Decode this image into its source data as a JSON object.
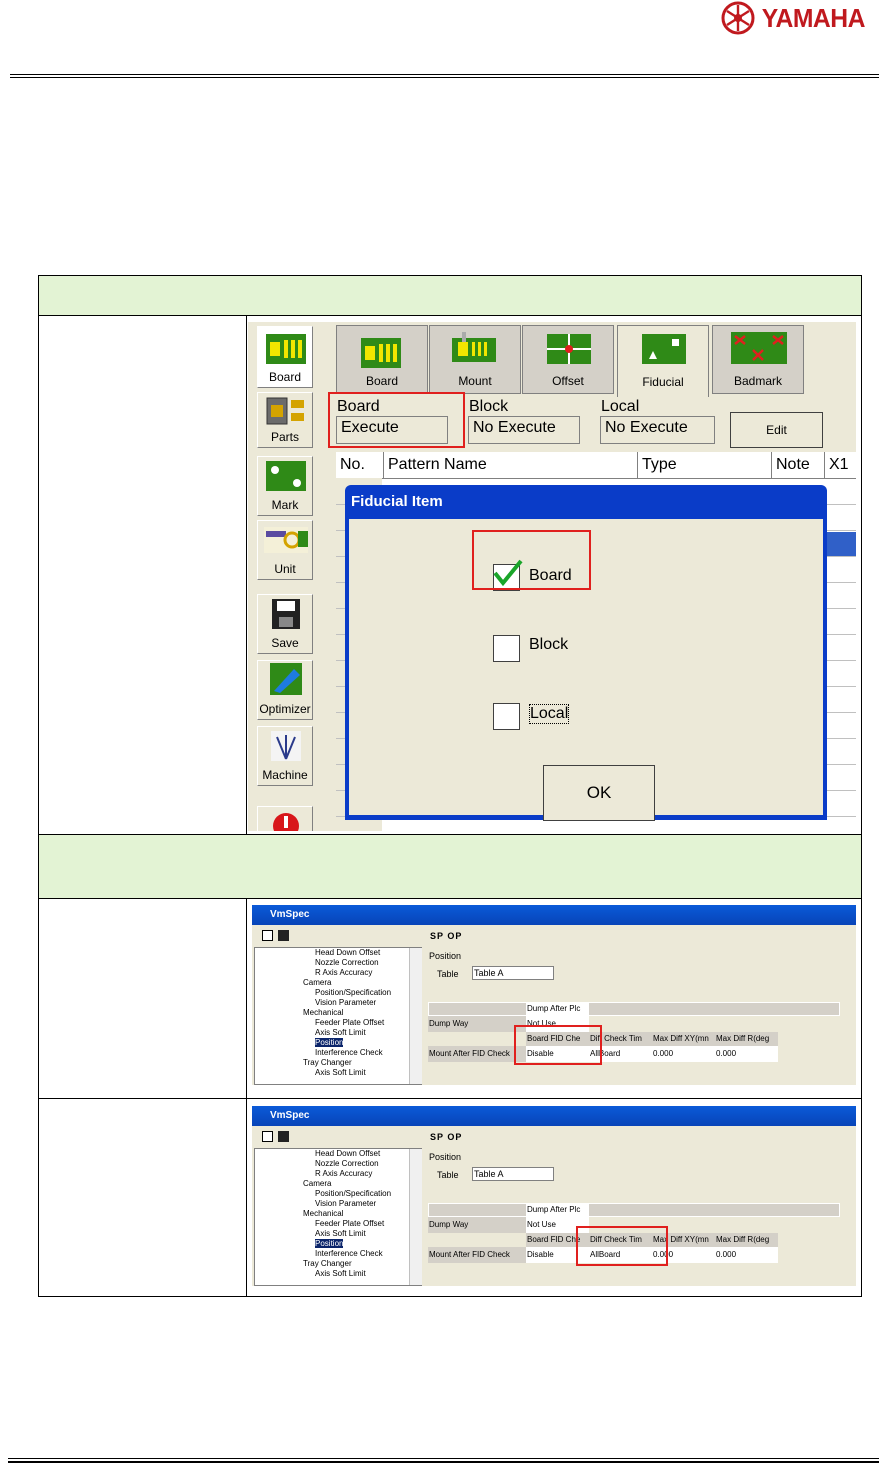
{
  "header": {
    "brand": "YAMAHA"
  },
  "app": {
    "sidebar": [
      "Board",
      "Parts",
      "Mark",
      "Unit",
      "Save",
      "Optimizer",
      "Machine"
    ],
    "tabs": [
      "Board",
      "Mount",
      "Offset",
      "Fiducial",
      "Badmark"
    ],
    "fields": [
      {
        "label": "Board",
        "value": "Execute"
      },
      {
        "label": "Block",
        "value": "No Execute"
      },
      {
        "label": "Local",
        "value": "No Execute"
      }
    ],
    "edit_button": "Edit",
    "columns": [
      "No.",
      "Pattern Name",
      "Type",
      "Note",
      "X1"
    ],
    "dialog": {
      "title": "Fiducial Item",
      "items": [
        {
          "label": "Board",
          "checked": true
        },
        {
          "label": "Block",
          "checked": false
        },
        {
          "label": "Local",
          "checked": false
        }
      ],
      "ok": "OK"
    }
  },
  "vmspec": {
    "title": "VmSpec",
    "toolbar": "SP OP",
    "tree": [
      "Head Down Offset",
      "Nozzle Correction",
      "R Axis Accuracy",
      "Camera",
      "Position/Specification",
      "Vision Parameter",
      "Mechanical",
      "Feeder Plate Offset",
      "Axis Soft Limit",
      "Position",
      "Interference Check",
      "Tray Changer",
      "Axis Soft Limit"
    ],
    "section": "Position",
    "table_label": "Table",
    "table_value": "Table A",
    "row1": {
      "h1": "Dump After Plc",
      "label": "Dump Way",
      "val": "Not Use"
    },
    "row2_headers": [
      "Board FID Che",
      "Diff Check Tim",
      "Max Diff XY(mn",
      "Max Diff R(deg"
    ],
    "row2": {
      "label": "Mount After FID Check",
      "values": [
        "Disable",
        "AllBoard",
        "0.000",
        "0.000"
      ]
    }
  }
}
